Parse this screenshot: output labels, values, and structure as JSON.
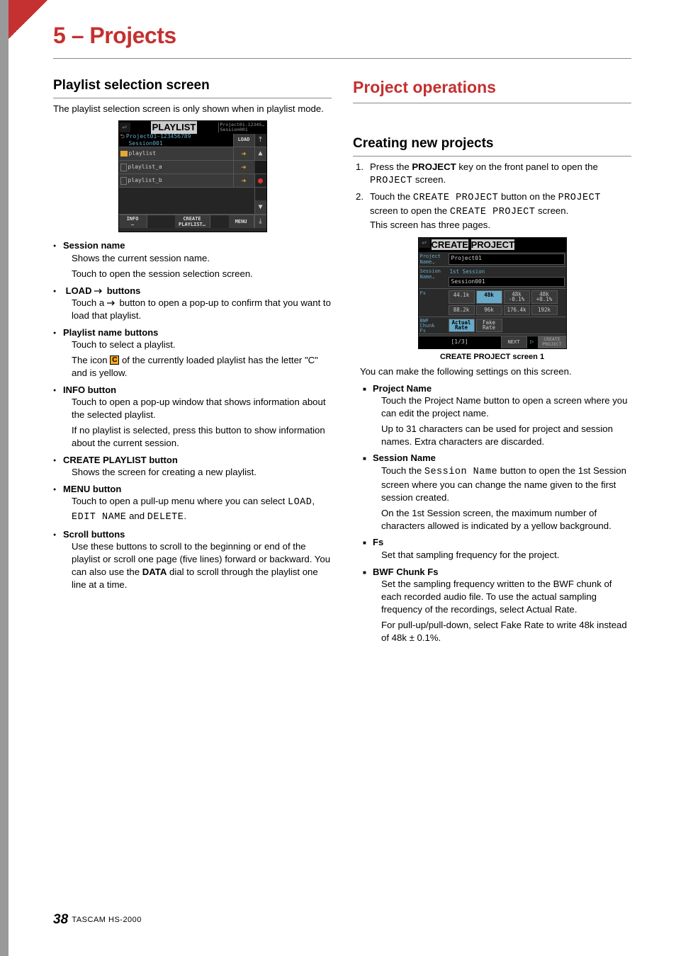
{
  "chapter": "5 – Projects",
  "footer_page": "38",
  "footer_label": "TASCAM HS-2000",
  "left": {
    "h2": "Playlist selection screen",
    "intro": "The playlist selection screen is only shown when in playlist mode.",
    "shot": {
      "title_left": "PLAYLIST",
      "title_sub1": "Project01-12345…",
      "title_sub2": "Session001",
      "row0_name": "Project01-123456789",
      "row0_sess": "Session001",
      "load": "LOAD",
      "row1": "playlist",
      "row2": "playlist_a",
      "row3": "playlist_b",
      "btn_info": "INFO",
      "btn_create1": "CREATE",
      "btn_create2": "PLAYLIST",
      "btn_menu": "MENU"
    },
    "items": [
      {
        "h": "Session name",
        "p": [
          "Shows the current session name.",
          "Touch to open the session selection screen."
        ]
      },
      {
        "h": "LOAD → buttons",
        "p": [
          "Touch a → button to open a pop-up to confirm that you want to load that playlist."
        ]
      },
      {
        "h": "Playlist name buttons",
        "p": [
          "Touch to select a playlist.",
          "The icon [C] of the currently loaded playlist has the letter \"C\" and is yellow."
        ]
      },
      {
        "h": "INFO button",
        "p": [
          "Touch to open a pop-up window that shows information about the selected playlist.",
          "If no playlist is selected, press this button to show information about the current session."
        ]
      },
      {
        "h": "CREATE PLAYLIST button",
        "p": [
          "Shows the screen for creating a new playlist."
        ]
      },
      {
        "h": "MENU button",
        "p_html": "Touch to open a pull-up menu where you can select"
      },
      {
        "h": "Scroll buttons",
        "p": [
          "Use these buttons to scroll to the beginning or end of the playlist or scroll one page (five lines) forward or backward. You can also use the DATA dial to scroll through the playlist one line at a time."
        ]
      }
    ],
    "menu_mono": {
      "a": "LOAD",
      "b": "EDIT NAME",
      "c": "DELETE"
    },
    "load_arrow_h_prefix": "LOAD",
    "load_arrow_h_suffix": "buttons",
    "playlist_icon_before": "The icon",
    "playlist_icon_after": "of the currently loaded playlist has the letter \"C\" and is yellow.",
    "touch_arrow_before": "Touch a",
    "touch_arrow_after": "button to open a pop-up to confirm that you want to load that playlist.",
    "menu_tail": "and",
    "menu_tail2": ".",
    "data_dial": "DATA",
    "scroll_before": "Use these buttons to scroll to the beginning or end of the playlist or scroll one page (five lines) forward or backward. You can also use the ",
    "scroll_after": " dial to scroll through the playlist one line at a time."
  },
  "right": {
    "h1": "Project operations",
    "h2": "Creating new projects",
    "steps": [
      {
        "n": "1.",
        "before": "Press the ",
        "bold": "PROJECT",
        "after": " key on the front panel to open the ",
        "mono": "PROJECT",
        "tail": " screen."
      },
      {
        "n": "2.",
        "before": "Touch the ",
        "mono1": "CREATE PROJECT",
        "mid": " button on the ",
        "mono2": "PROJECT",
        "after": " screen to open the ",
        "mono3": "CREATE PROJECT",
        "tail": " screen.",
        "line2": "This screen has three pages."
      }
    ],
    "shot": {
      "title_left": "CREATE",
      "title_right": "PROJECT",
      "proj_label": "Project Name",
      "proj_val": "Project01",
      "sess_label": "Session Name",
      "sess_sub": "1st Session",
      "sess_val": "Session001",
      "fs_label": "Fs",
      "bwf_label1": "BWF",
      "bwf_label2": "Chunk",
      "bwf_label3": "Fs",
      "fs_vals": [
        "44.1k",
        "48k",
        "48k -0.1%",
        "48k +0.1%",
        "88.2k",
        "96k",
        "176.4k",
        "192k"
      ],
      "bwf_vals": [
        "Actual Rate",
        "Fake Rate"
      ],
      "page": "[1/3]",
      "next": "NEXT",
      "create1": "CREATE",
      "create2": "PROJECT"
    },
    "caption": "CREATE PROJECT screen 1",
    "subintro": "You can make the following settings on this screen.",
    "items": [
      {
        "h": "Project Name",
        "p": [
          "Touch the Project Name button to open a screen where you can edit the project name.",
          "Up to 31 characters can be used for project and session names. Extra characters are discarded."
        ]
      },
      {
        "h": "Session Name",
        "p_html": "sess"
      },
      {
        "h": "Fs",
        "p": [
          "Set that sampling frequency for the project."
        ]
      },
      {
        "h": "BWF Chunk Fs",
        "p": [
          "Set the sampling frequency written to the BWF chunk of each recorded audio file. To use the actual sampling frequency of the recordings, select Actual Rate.",
          "For pull-up/pull-down, select Fake Rate to write 48k instead of 48k ± 0.1%."
        ]
      }
    ],
    "sess": {
      "before": "Touch the ",
      "mono": "Session Name",
      "after": " button to open the 1st Session screen where you can change the name given to the first session created.",
      "p2": "On the 1st Session screen, the maximum number of characters allowed is indicated by a yellow background."
    }
  }
}
